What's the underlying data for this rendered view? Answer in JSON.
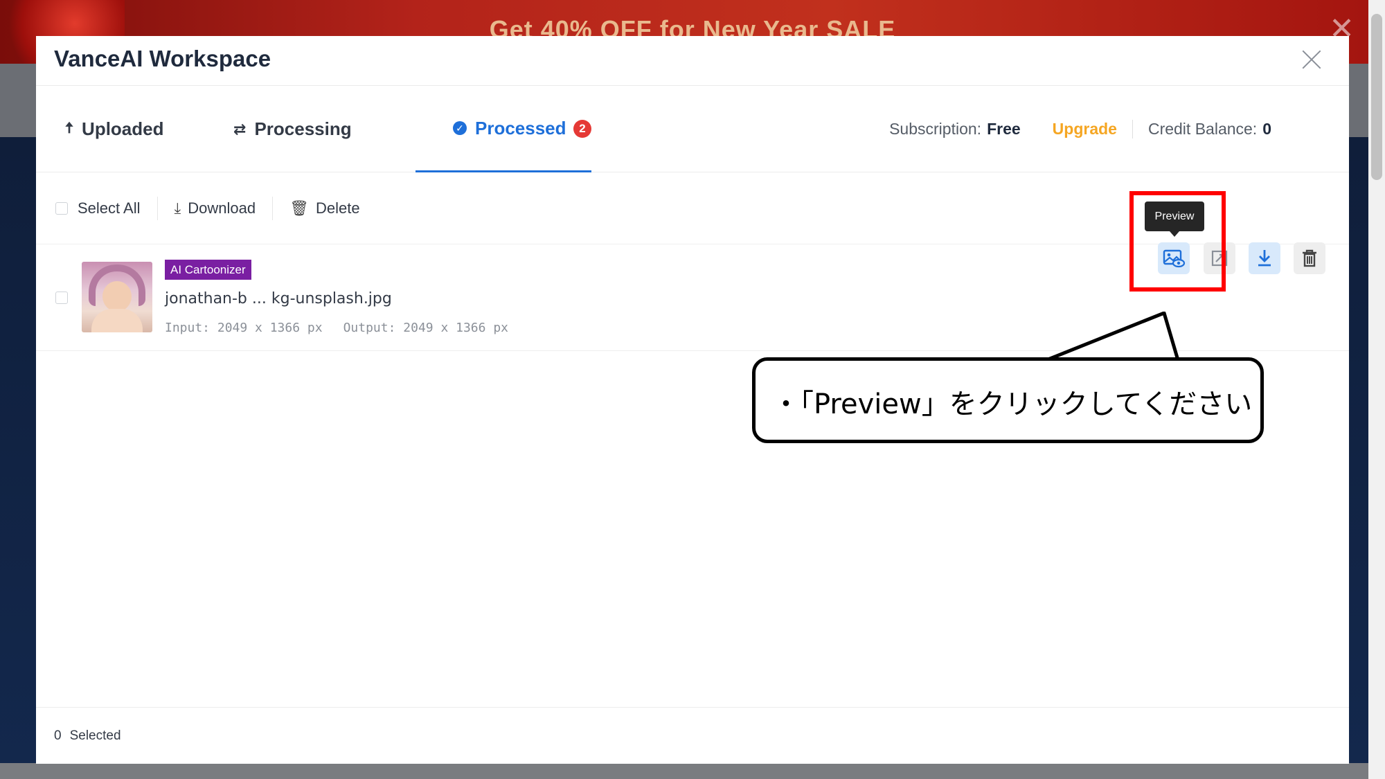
{
  "promo": {
    "text": "Get 40% OFF for New Year SALE"
  },
  "modal": {
    "title": "VanceAI Workspace",
    "tabs": [
      {
        "label": "Uploaded",
        "icon": "upload-arrow-icon"
      },
      {
        "label": "Processing",
        "icon": "refresh-icon"
      },
      {
        "label": "Processed",
        "icon": "check-circle-icon",
        "badge": "2",
        "active": true
      }
    ],
    "subscription": {
      "label": "Subscription:",
      "value": "Free",
      "upgrade": "Upgrade",
      "credit_label": "Credit Balance:",
      "credit_value": "0"
    },
    "toolbar": {
      "select_all": "Select All",
      "download": "Download",
      "delete": "Delete"
    },
    "files": [
      {
        "tag": "AI Cartoonizer",
        "name": "jonathan-b ... kg-unsplash.jpg",
        "input": "Input: 2049 x 1366 px",
        "output": "Output: 2049 x 1366 px"
      }
    ],
    "actions": {
      "tooltip": "Preview"
    },
    "footer": {
      "count": "0",
      "label": "Selected"
    }
  },
  "callout": {
    "text": "・「Preview」をクリックしてください"
  },
  "colors": {
    "accent": "#1e6fd9",
    "upgrade": "#f5a623",
    "tag": "#7a1fa2",
    "badge": "#e53935",
    "highlight": "#ff0000"
  }
}
